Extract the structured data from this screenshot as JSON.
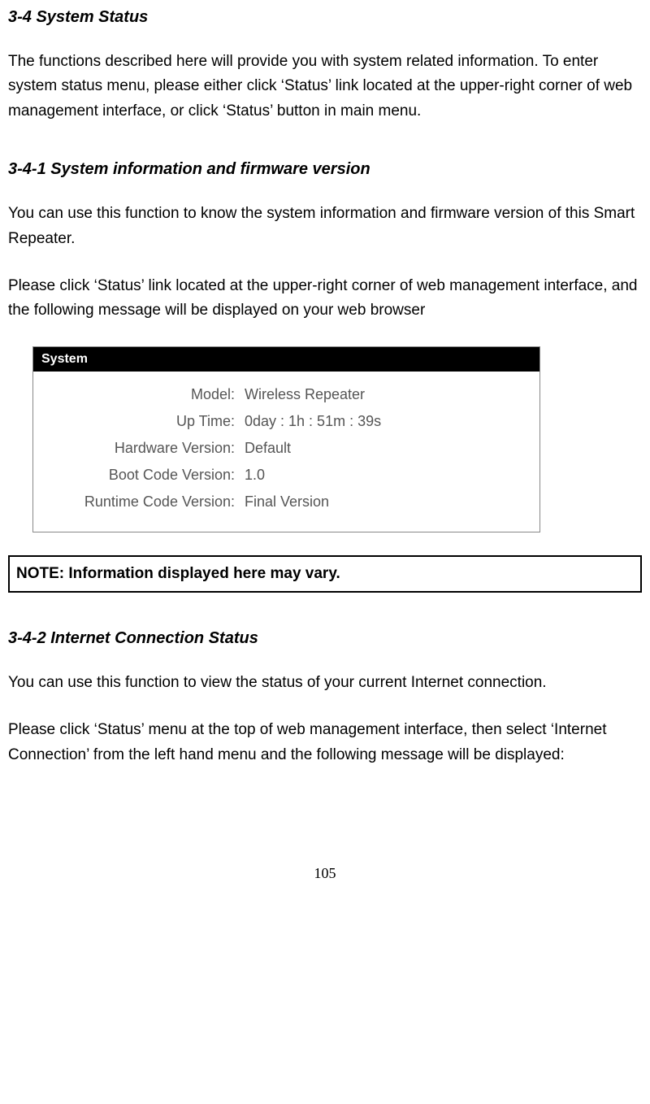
{
  "sections": {
    "s1": {
      "heading": "3-4 System Status",
      "para1": "The functions described here will provide you with system related information. To enter system status menu, please either click ‘Status’ link located at the upper-right corner of web management interface, or click ‘Status’ button in main menu."
    },
    "s2": {
      "heading": "3-4-1 System information and firmware version",
      "para1": "You can use this function to know the system information and firmware version of this Smart Repeater.",
      "para2": "Please click ‘Status’ link located at the upper-right corner of web management interface, and the following message will be displayed on your web browser"
    },
    "panel": {
      "title": "System",
      "rows": {
        "model": {
          "label": "Model:",
          "value": "Wireless Repeater"
        },
        "uptime": {
          "label": "Up Time:",
          "value": "0day : 1h : 51m : 39s"
        },
        "hwver": {
          "label": "Hardware Version:",
          "value": "Default"
        },
        "bootcode": {
          "label": "Boot Code Version:",
          "value": "1.0"
        },
        "runtime": {
          "label": "Runtime Code Version:",
          "value": "Final Version"
        }
      }
    },
    "note": "NOTE: Information displayed here may vary.",
    "s3": {
      "heading": "3-4-2 Internet Connection Status",
      "para1": "You can use this function to view the status of your current Internet connection.",
      "para2": "Please click ‘Status’ menu at the top of web management interface, then select ‘Internet Connection’ from the left hand menu and the following message will be displayed:"
    }
  },
  "page_number": "105"
}
